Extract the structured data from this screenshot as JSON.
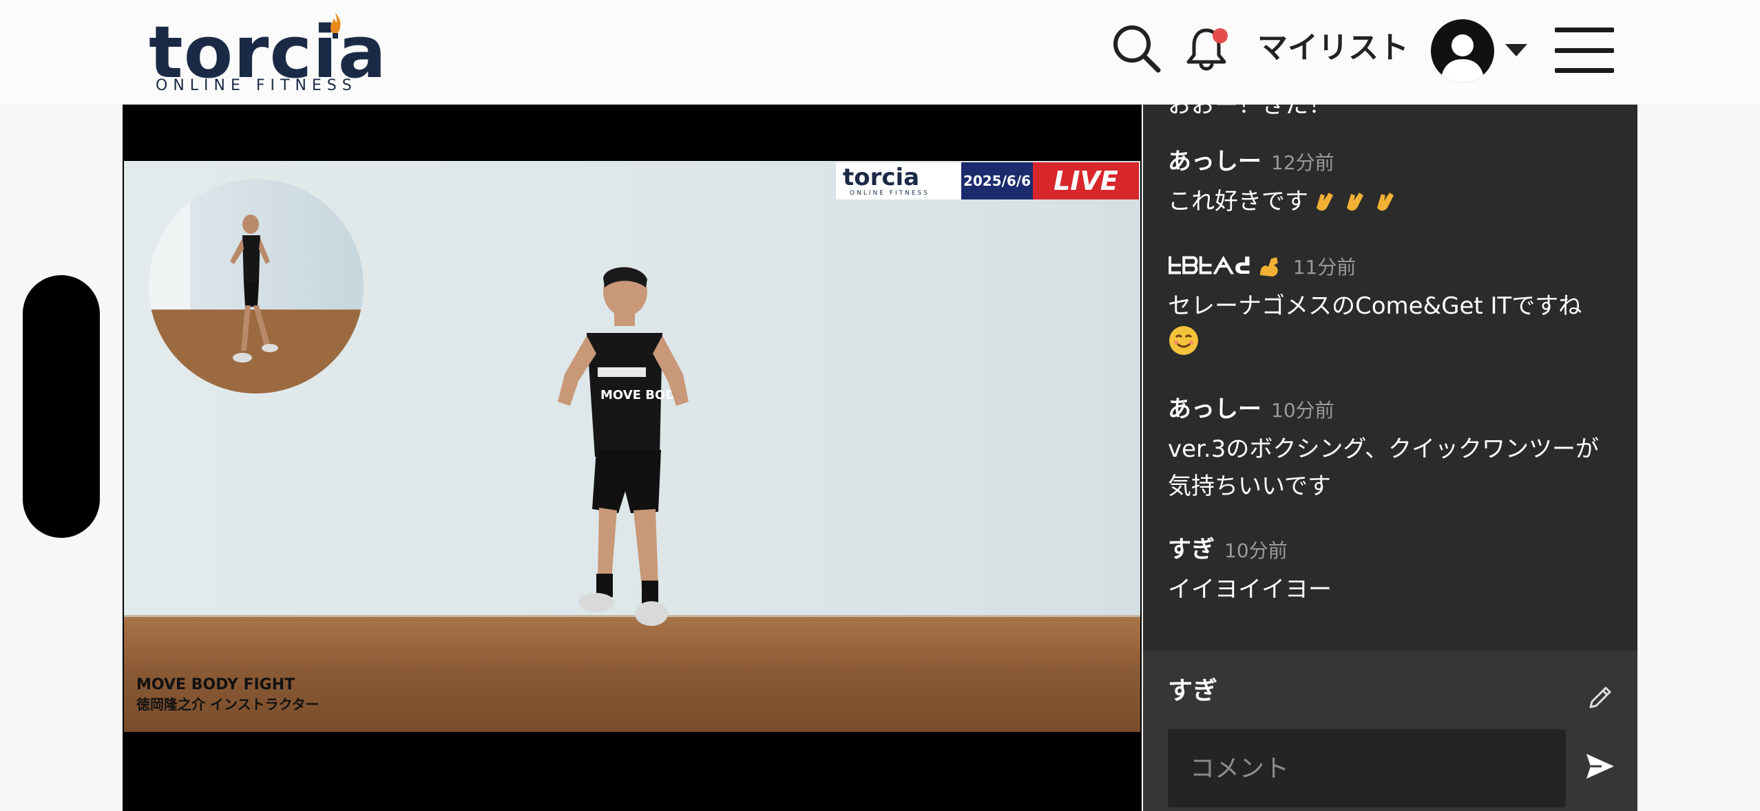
{
  "header": {
    "logo_word": "torcia",
    "logo_sub": "ONLINE FITNESS",
    "mylist_label": "マイリスト"
  },
  "video": {
    "badge_logo_word": "torcia",
    "badge_logo_sub": "ONLINE FITNESS",
    "badge_date": "2025/6/6",
    "badge_live": "LIVE",
    "caption_title": "MOVE BODY FIGHT",
    "caption_sub": "徳岡隆之介 インストラクター"
  },
  "chat": {
    "messages": [
      {
        "name": "",
        "time": "",
        "body": "おおー！きた！"
      },
      {
        "name": "あっしー",
        "time": "12分前",
        "body": "これ好きです"
      },
      {
        "name": "ᖶᗷᖶᗅᕍ",
        "time": "11分前",
        "body": "セレーナゴメスのCome&Get ITですね"
      },
      {
        "name": "あっしー",
        "time": "10分前",
        "body": "ver.3のボクシング、クイックワンツーが気持ちいいです"
      },
      {
        "name": "すぎ",
        "time": "10分前",
        "body": "イイヨイイヨー"
      }
    ],
    "input": {
      "user_name": "すぎ",
      "placeholder": "コメント"
    }
  },
  "colors": {
    "brand_navy": "#1a2a46",
    "live_red": "#d8272b",
    "notification_dot": "#e74c4c",
    "chat_bg": "#2b2b2b"
  }
}
